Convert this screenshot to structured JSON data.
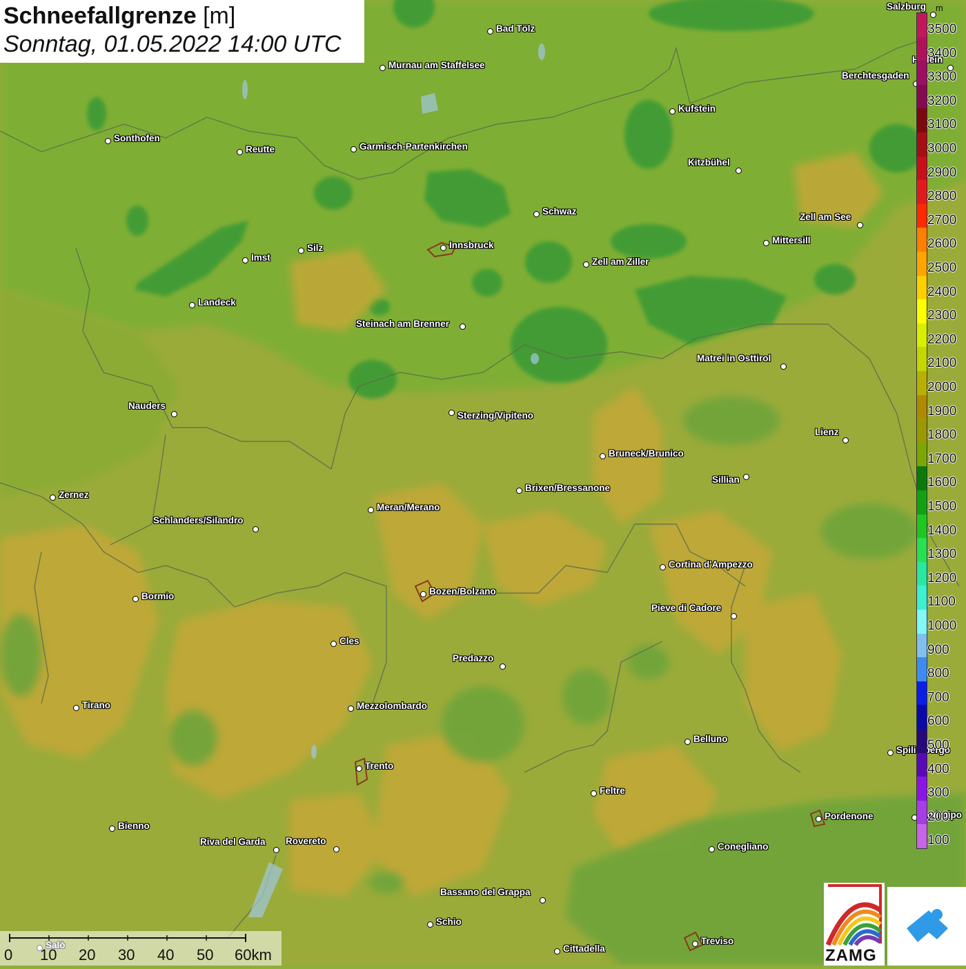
{
  "title": {
    "main": "Schneefallgrenze",
    "unit": "[m]",
    "subtitle": "Sonntag, 01.05.2022 14:00 UTC"
  },
  "legend": {
    "unit": "m",
    "levels": [
      {
        "label": "3500",
        "color": "#c2185b"
      },
      {
        "label": "3400",
        "color": "#b0125a"
      },
      {
        "label": "3300",
        "color": "#9c0f63"
      },
      {
        "label": "3200",
        "color": "#860a52"
      },
      {
        "label": "3100",
        "color": "#7a0a10"
      },
      {
        "label": "3000",
        "color": "#a50f15"
      },
      {
        "label": "2900",
        "color": "#c8101a"
      },
      {
        "label": "2800",
        "color": "#e31a1c"
      },
      {
        "label": "2700",
        "color": "#ff2a00"
      },
      {
        "label": "2600",
        "color": "#ff7f00"
      },
      {
        "label": "2500",
        "color": "#ffa500"
      },
      {
        "label": "2400",
        "color": "#ffd000"
      },
      {
        "label": "2300",
        "color": "#ffff00"
      },
      {
        "label": "2200",
        "color": "#d8f000"
      },
      {
        "label": "2100",
        "color": "#c4d800"
      },
      {
        "label": "2000",
        "color": "#b8b000"
      },
      {
        "label": "1900",
        "color": "#b08a00"
      },
      {
        "label": "1800",
        "color": "#9a9a00"
      },
      {
        "label": "1700",
        "color": "#7aa800"
      },
      {
        "label": "1600",
        "color": "#0a7a0a"
      },
      {
        "label": "1500",
        "color": "#14a014"
      },
      {
        "label": "1400",
        "color": "#1ec81e"
      },
      {
        "label": "1300",
        "color": "#28e050"
      },
      {
        "label": "1200",
        "color": "#28e8a0"
      },
      {
        "label": "1100",
        "color": "#3cf0d0"
      },
      {
        "label": "1000",
        "color": "#80f8f8"
      },
      {
        "label": "900",
        "color": "#80c0f0"
      },
      {
        "label": "800",
        "color": "#3c8cf0"
      },
      {
        "label": "700",
        "color": "#0a1ee8"
      },
      {
        "label": "600",
        "color": "#0a0aa8"
      },
      {
        "label": "500",
        "color": "#28087a"
      },
      {
        "label": "400",
        "color": "#5a0ab4"
      },
      {
        "label": "300",
        "color": "#8c14e6"
      },
      {
        "label": "200",
        "color": "#a83ce6"
      },
      {
        "label": "100",
        "color": "#c864e6"
      }
    ]
  },
  "cities": [
    {
      "name": "Bad Tölz"
    },
    {
      "name": "Murnau am Staffelsee"
    },
    {
      "name": "Salzburg"
    },
    {
      "name": "Hallein"
    },
    {
      "name": "Berchtesgaden"
    },
    {
      "name": "Kufstein"
    },
    {
      "name": "Sonthofen"
    },
    {
      "name": "Reutte"
    },
    {
      "name": "Garmisch-Partenkirchen"
    },
    {
      "name": "Kitzbühel"
    },
    {
      "name": "Schwaz"
    },
    {
      "name": "Zell am See"
    },
    {
      "name": "Innsbruck"
    },
    {
      "name": "Mittersill"
    },
    {
      "name": "Imst"
    },
    {
      "name": "Silz"
    },
    {
      "name": "Zell am Ziller"
    },
    {
      "name": "Landeck"
    },
    {
      "name": "Steinach am Brenner"
    },
    {
      "name": "Matrei in Osttirol"
    },
    {
      "name": "Nauders"
    },
    {
      "name": "Sterzing/Vipiteno"
    },
    {
      "name": "Lienz"
    },
    {
      "name": "Bruneck/Brunico"
    },
    {
      "name": "Sillian"
    },
    {
      "name": "Zernez"
    },
    {
      "name": "Brixen/Bressanone"
    },
    {
      "name": "Meran/Merano"
    },
    {
      "name": "Schlanders/Silandro"
    },
    {
      "name": "Cortina d'Ampezzo"
    },
    {
      "name": "Bozen/Bolzano"
    },
    {
      "name": "Bormio"
    },
    {
      "name": "Pieve di Cadore"
    },
    {
      "name": "Cles"
    },
    {
      "name": "Predazzo"
    },
    {
      "name": "Tirano"
    },
    {
      "name": "Mezzolombardo"
    },
    {
      "name": "Belluno"
    },
    {
      "name": "Spilimbergo"
    },
    {
      "name": "Trento"
    },
    {
      "name": "Feltre"
    },
    {
      "name": "Pordenone"
    },
    {
      "name": "Bienno"
    },
    {
      "name": "Riva del Garda"
    },
    {
      "name": "Rovereto"
    },
    {
      "name": "Conegliano"
    },
    {
      "name": "Bassano del Grappa"
    },
    {
      "name": "Schio"
    },
    {
      "name": "Treviso"
    },
    {
      "name": "Cittadella"
    },
    {
      "name": "Codroipo"
    },
    {
      "name": "Salò"
    }
  ],
  "scale": {
    "labels": [
      "0",
      "10",
      "20",
      "30",
      "40",
      "50",
      "60km"
    ]
  },
  "logos": {
    "zamg": "ZAMG"
  }
}
